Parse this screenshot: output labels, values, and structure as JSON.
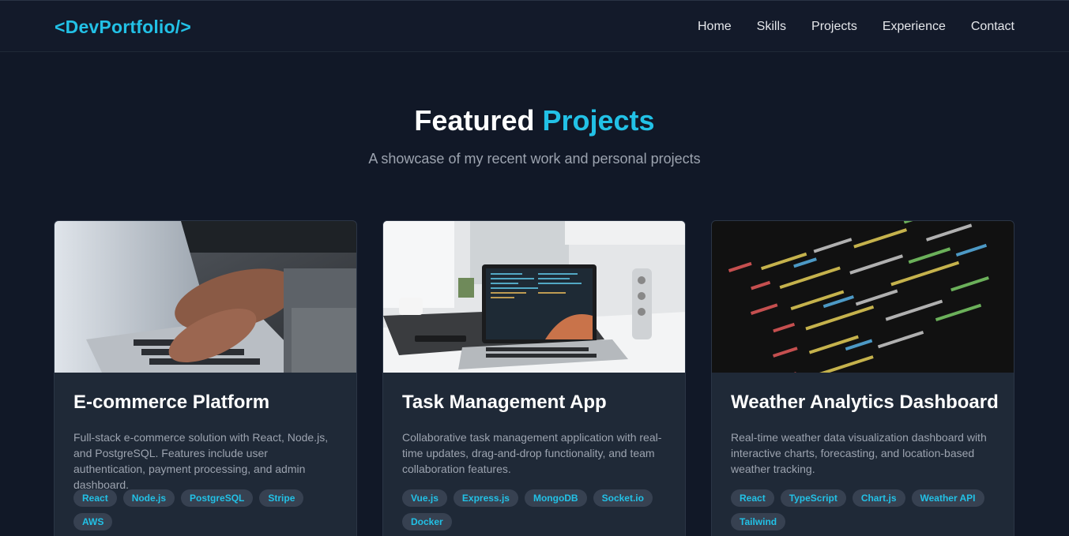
{
  "nav": {
    "logo": "<DevPortfolio/>",
    "links": [
      "Home",
      "Skills",
      "Projects",
      "Experience",
      "Contact"
    ]
  },
  "hero": {
    "title_main": "Featured",
    "title_accent": "Projects",
    "subtitle": "A showcase of my recent work and personal projects"
  },
  "projects": [
    {
      "title": "E-commerce Platform",
      "description": "Full-stack e-commerce solution with React, Node.js, and PostgreSQL. Features include user authentication, payment processing, and admin dashboard.",
      "tags": [
        "React",
        "Node.js",
        "PostgreSQL",
        "Stripe",
        "AWS"
      ]
    },
    {
      "title": "Task Management App",
      "description": "Collaborative task management application with real-time updates, drag-and-drop functionality, and team collaboration features.",
      "tags": [
        "Vue.js",
        "Express.js",
        "MongoDB",
        "Socket.io",
        "Docker"
      ]
    },
    {
      "title": "Weather Analytics Dashboard",
      "description": "Real-time weather data visualization dashboard with interactive charts, forecasting, and location-based weather tracking.",
      "tags": [
        "React",
        "TypeScript",
        "Chart.js",
        "Weather API",
        "Tailwind"
      ]
    }
  ],
  "colors": {
    "accent": "#22c1e6",
    "background": "#111827",
    "card": "#1f2937",
    "tag_bg": "#374151"
  }
}
